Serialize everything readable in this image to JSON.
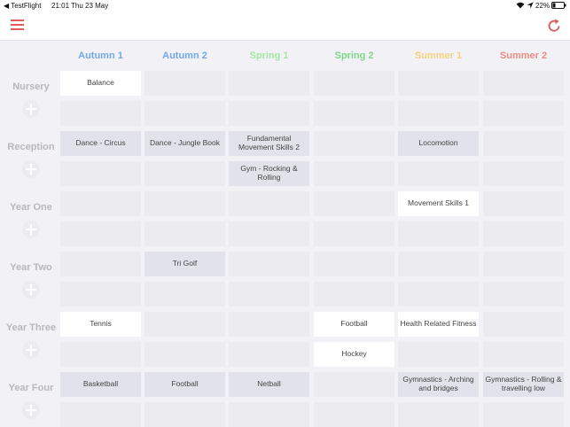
{
  "status_bar": {
    "back_app": "TestFlight",
    "time": "21:01",
    "date": "Thu 23 May",
    "battery": "22%"
  },
  "columns": [
    {
      "label": "Autumn 1",
      "color": "#72a8e6"
    },
    {
      "label": "Autumn 2",
      "color": "#72a8e6"
    },
    {
      "label": "Spring 1",
      "color": "#a6e6a6"
    },
    {
      "label": "Spring 2",
      "color": "#7fd889"
    },
    {
      "label": "Summer 1",
      "color": "#f4d27e"
    },
    {
      "label": "Summer 2",
      "color": "#ef8b82"
    }
  ],
  "rows": [
    {
      "label": "Nursery",
      "slots": [
        [
          "Balance",
          "",
          "",
          "",
          "",
          ""
        ],
        [
          "",
          "",
          "",
          "",
          "",
          ""
        ]
      ]
    },
    {
      "label": "Reception",
      "slots": [
        [
          "Dance - Circus",
          "Dance - Jungle Book",
          "Fundamental Movement Skills 2",
          "",
          "Locomotion",
          ""
        ],
        [
          "",
          "",
          "Gym - Rocking & Rolling",
          "",
          "",
          ""
        ]
      ]
    },
    {
      "label": "Year One",
      "slots": [
        [
          "",
          "",
          "",
          "",
          "Movement Skills 1",
          ""
        ],
        [
          "",
          "",
          "",
          "",
          "",
          ""
        ]
      ]
    },
    {
      "label": "Year Two",
      "slots": [
        [
          "",
          "Tri Golf",
          "",
          "",
          "",
          ""
        ],
        [
          "",
          "",
          "",
          "",
          "",
          ""
        ]
      ]
    },
    {
      "label": "Year Three",
      "slots": [
        [
          "Tennis",
          "",
          "",
          "Football",
          "Health Related Fitness",
          ""
        ],
        [
          "",
          "",
          "",
          "Hockey",
          "",
          ""
        ]
      ]
    },
    {
      "label": "Year Four",
      "slots": [
        [
          "Basketball",
          "Football",
          "Netball",
          "",
          "Gymnastics - Arching and bridges",
          "Gymnastics - Rolling & travelling low"
        ],
        [
          "",
          "",
          "",
          "",
          "",
          ""
        ]
      ]
    }
  ],
  "colors": {
    "accent": "#e05a5a",
    "row_label": "#b7b7bd"
  }
}
